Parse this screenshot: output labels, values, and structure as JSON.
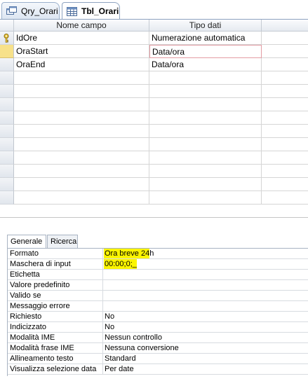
{
  "tabs": [
    {
      "label": "Qry_Orari",
      "icon": "query-icon"
    },
    {
      "label": "Tbl_Orari",
      "icon": "table-icon"
    }
  ],
  "grid": {
    "headers": [
      "Nome campo",
      "Tipo dati"
    ],
    "rows": [
      {
        "field": "IdOre",
        "type": "Numerazione automatica",
        "primary_key": true
      },
      {
        "field": "OraStart",
        "type": "Data/ora",
        "current": true
      },
      {
        "field": "OraEnd",
        "type": "Data/ora"
      }
    ]
  },
  "property_tabs": [
    "Generale",
    "Ricerca"
  ],
  "properties": [
    {
      "name": "Formato",
      "value": "Ora breve 24h",
      "highlight": true
    },
    {
      "name": "Maschera di input",
      "value": "00:00;0;_",
      "highlight": true
    },
    {
      "name": "Etichetta",
      "value": ""
    },
    {
      "name": "Valore predefinito",
      "value": ""
    },
    {
      "name": "Valido se",
      "value": ""
    },
    {
      "name": "Messaggio errore",
      "value": ""
    },
    {
      "name": "Richiesto",
      "value": "No"
    },
    {
      "name": "Indicizzato",
      "value": "No"
    },
    {
      "name": "Modalità IME",
      "value": "Nessun controllo"
    },
    {
      "name": "Modalità frase IME",
      "value": "Nessuna conversione"
    },
    {
      "name": "Allineamento testo",
      "value": "Standard"
    },
    {
      "name": "Visualizza selezione data",
      "value": "Per date"
    }
  ],
  "colors": {
    "highlight": "#fbf500",
    "current_row": "#f7e18a",
    "active_cell_border": "#e39ca3"
  }
}
